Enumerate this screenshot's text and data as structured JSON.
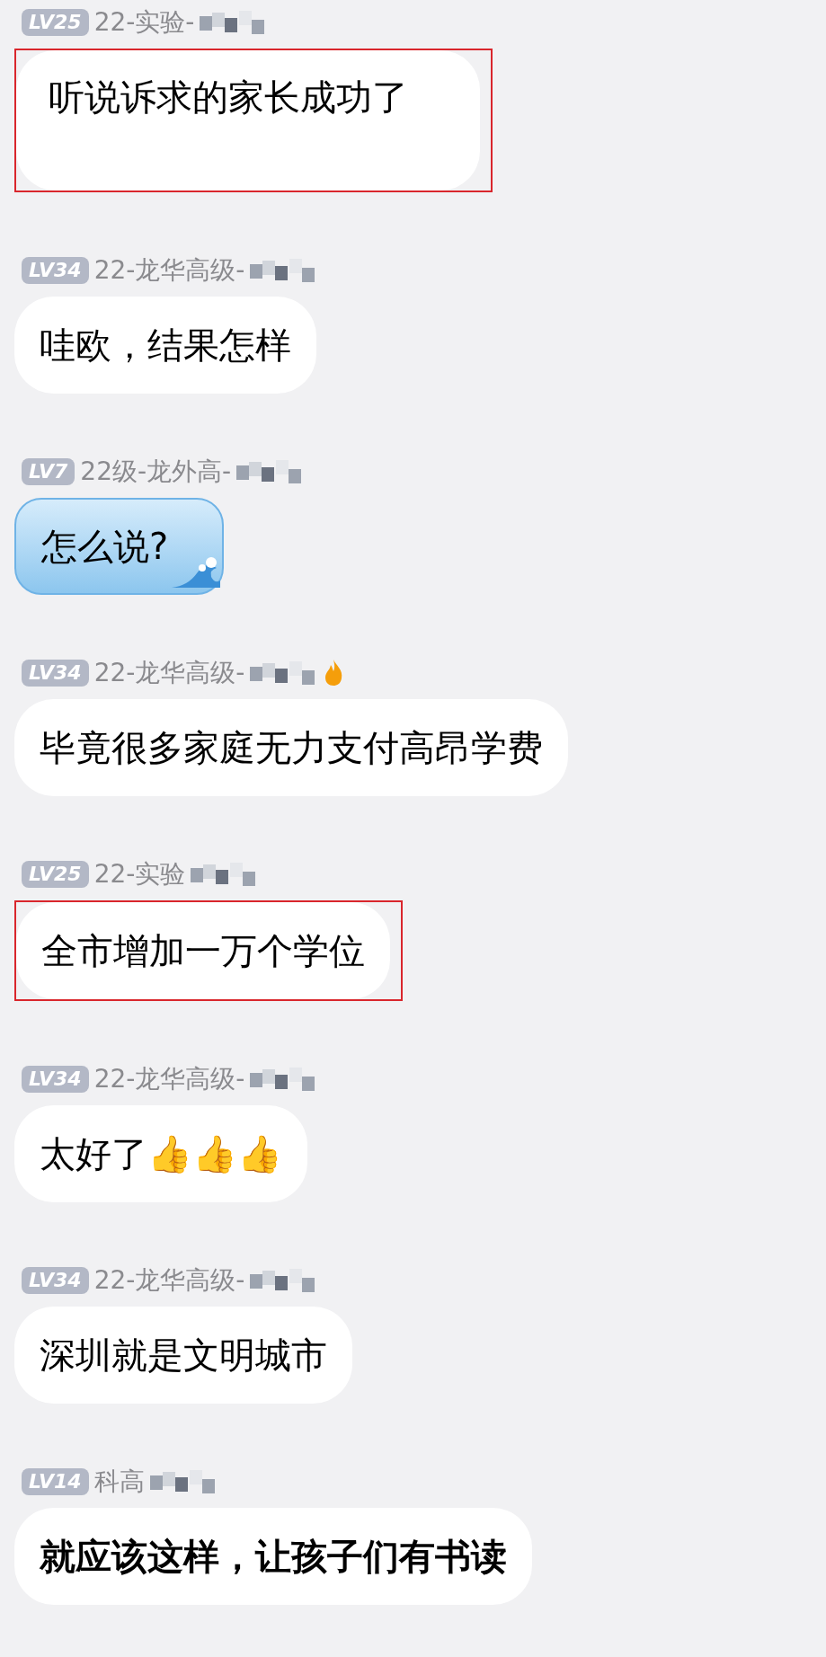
{
  "messages": [
    {
      "level_badge": "LV25",
      "sender": "22-实验-",
      "text": "听说诉求的家长成功了",
      "kind": "tall",
      "highlighted": true,
      "fire_badge": false
    },
    {
      "level_badge": "LV34",
      "sender": "22-龙华高级-",
      "text": "哇欧，结果怎样",
      "kind": "plain",
      "highlighted": false,
      "fire_badge": false
    },
    {
      "level_badge": "LV7",
      "sender": "22级-龙外高-",
      "text": "怎么说?",
      "kind": "wave",
      "highlighted": false,
      "fire_badge": false
    },
    {
      "level_badge": "LV34",
      "sender": "22-龙华高级-",
      "text": "毕竟很多家庭无力支付高昂学费",
      "kind": "plain",
      "highlighted": false,
      "fire_badge": true
    },
    {
      "level_badge": "LV25",
      "sender": "22-实验",
      "text": "全市增加一万个学位",
      "kind": "plain",
      "highlighted": true,
      "fire_badge": false
    },
    {
      "level_badge": "LV34",
      "sender": "22-龙华高级-",
      "text": "太好了👍👍👍",
      "kind": "plain",
      "highlighted": false,
      "fire_badge": false
    },
    {
      "level_badge": "LV34",
      "sender": "22-龙华高级-",
      "text": "深圳就是文明城市",
      "kind": "plain",
      "highlighted": false,
      "fire_badge": false
    },
    {
      "level_badge": "LV14",
      "sender": "科高",
      "text": "就应该这样，让孩子们有书读",
      "kind": "handwritten",
      "highlighted": false,
      "fire_badge": false
    }
  ]
}
